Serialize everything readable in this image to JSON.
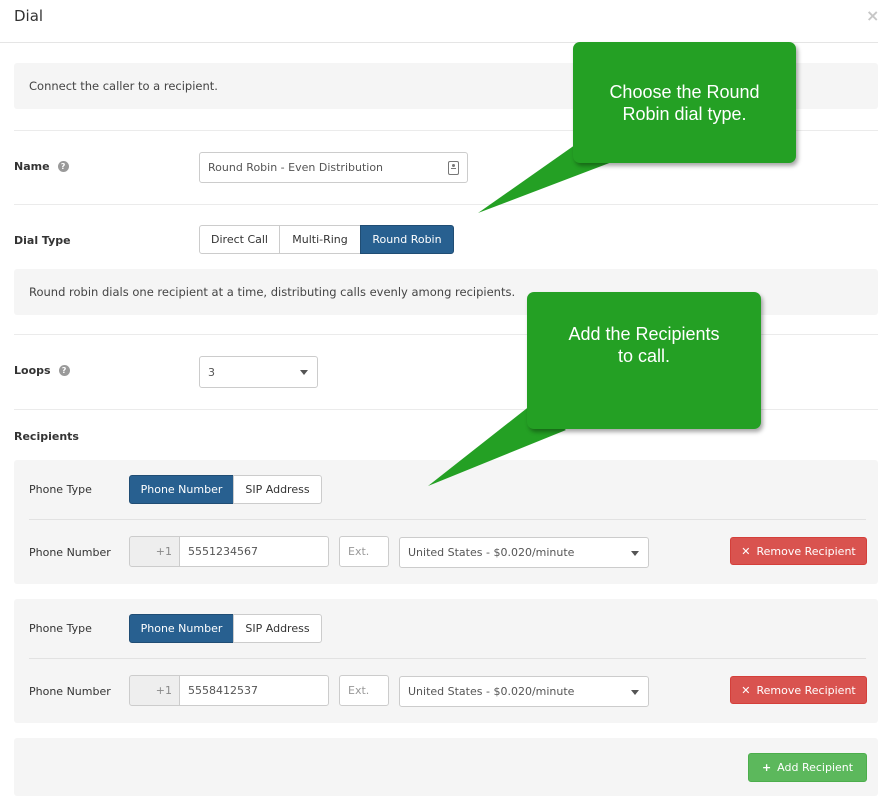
{
  "modal": {
    "title": "Dial",
    "close": "×"
  },
  "info_connect": "Connect the caller to a recipient.",
  "name_field": {
    "label": "Name",
    "value": "Round Robin - Even Distribution"
  },
  "dial_type": {
    "label": "Dial Type",
    "options": [
      "Direct Call",
      "Multi-Ring",
      "Round Robin"
    ],
    "selected": "Round Robin",
    "description": "Round robin dials one recipient at a time, distributing calls evenly among recipients."
  },
  "loops": {
    "label": "Loops",
    "value": "3"
  },
  "recipients": {
    "heading": "Recipients",
    "phone_type_label": "Phone Type",
    "phone_type_options": [
      "Phone Number",
      "SIP Address"
    ],
    "phone_number_label": "Phone Number",
    "ext_placeholder": "Ext.",
    "remove_label": "Remove Recipient",
    "items": [
      {
        "phone_type": "Phone Number",
        "country_code": "+1",
        "number": "5551234567",
        "rate": "United States - $0.020/minute"
      },
      {
        "phone_type": "Phone Number",
        "country_code": "+1",
        "number": "5558412537",
        "rate": "United States - $0.020/minute"
      }
    ]
  },
  "add_recipient_label": "Add Recipient",
  "callouts": [
    {
      "text": "Choose the Round Robin dial type."
    },
    {
      "text": "Add the Recipients to call."
    }
  ],
  "colors": {
    "primary": "#286090",
    "danger": "#d9534f",
    "success": "#5cb85c",
    "callout_green": "#24a024"
  },
  "icons": {
    "help": "question-circle-icon",
    "contact": "contact-card-icon",
    "remove": "times-icon",
    "add": "plus-icon"
  }
}
